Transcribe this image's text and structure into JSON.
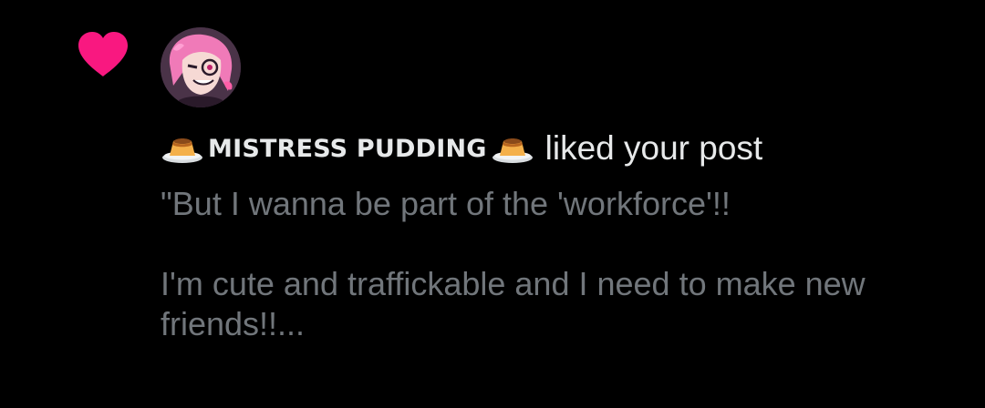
{
  "notification": {
    "type_icon": "heart-icon",
    "user": {
      "display_name": "MISTRESS PUDDING",
      "avatar_icon": "avatar",
      "name_emoji": "pudding-icon"
    },
    "action_text": "liked your post",
    "post_preview": "\"But I wanna be part of the 'workforce'!!\n\nI'm cute and traffickable and I need to make new friends!!..."
  },
  "colors": {
    "background": "#000000",
    "heart": "#f91880",
    "primary_text": "#e7e9ea",
    "secondary_text": "#71767b"
  }
}
